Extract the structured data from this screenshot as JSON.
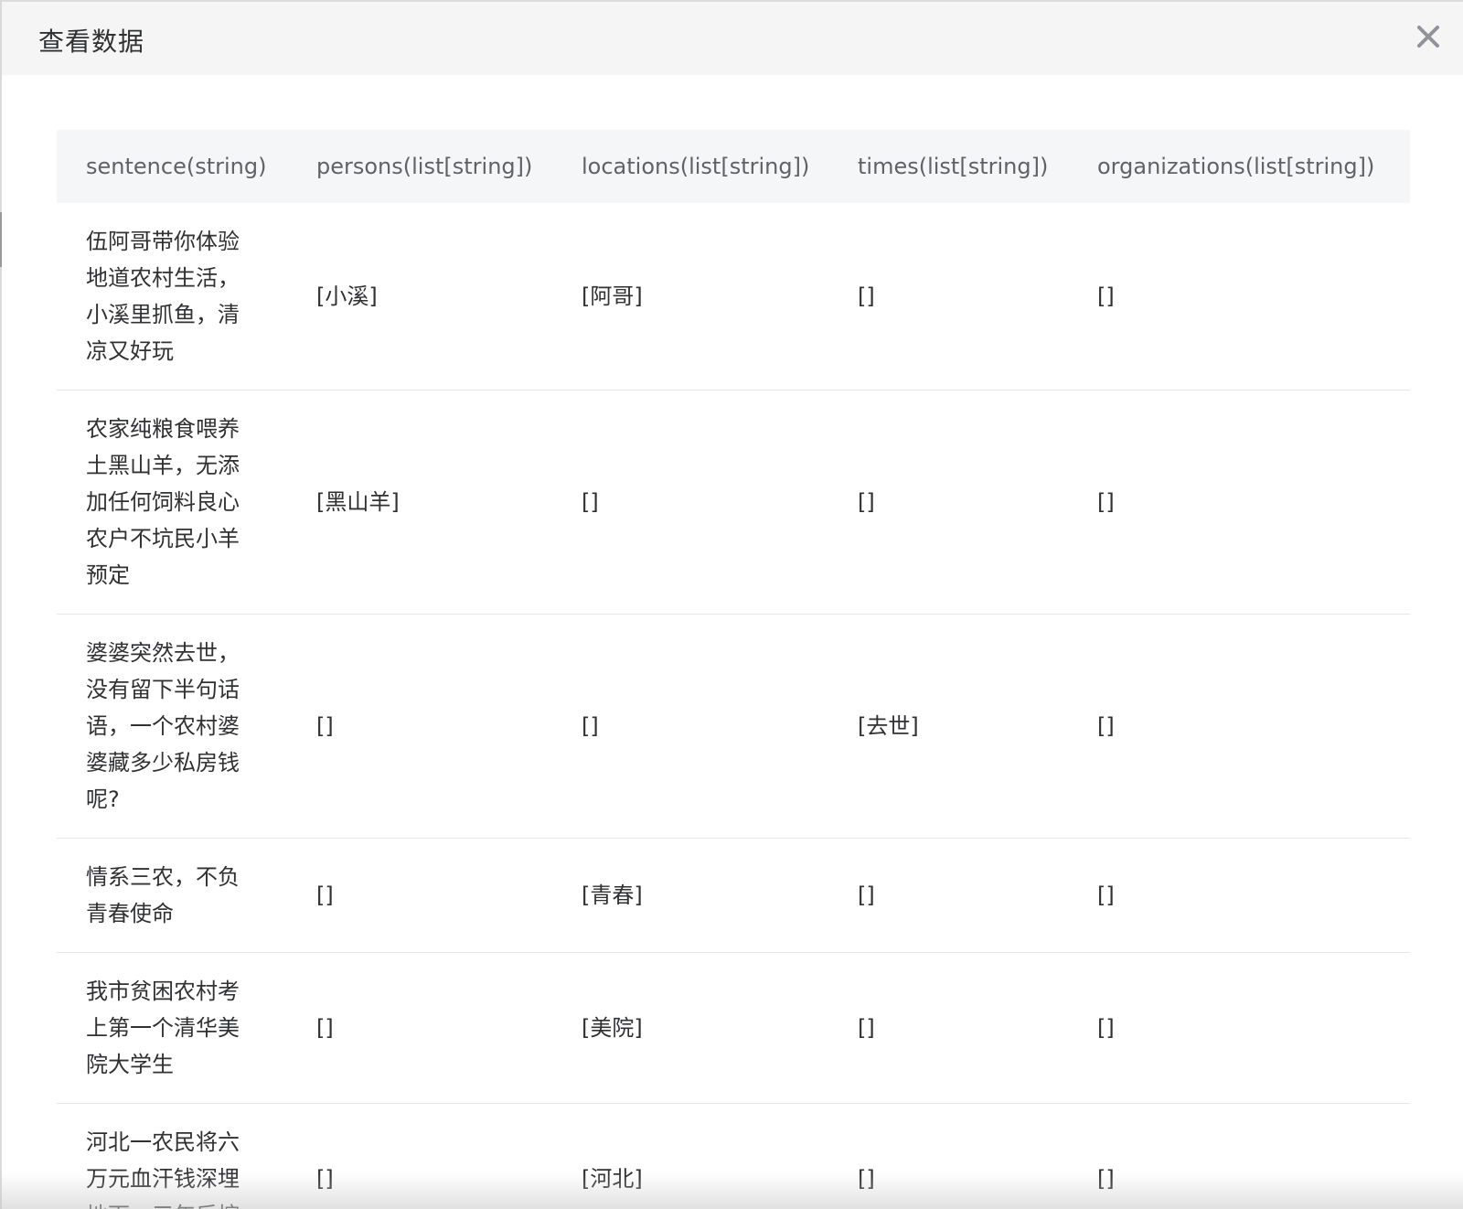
{
  "dialog": {
    "title": "查看数据",
    "close_icon": "close-icon"
  },
  "table": {
    "columns": [
      "sentence(string)",
      "persons(list[string])",
      "locations(list[string])",
      "times(list[string])",
      "organizations(list[string])"
    ],
    "rows": [
      {
        "sentence": "伍阿哥带你体验地道农村生活，小溪里抓鱼，清凉又好玩",
        "persons": "[小溪]",
        "locations": "[阿哥]",
        "times": "[]",
        "organizations": "[]"
      },
      {
        "sentence": "农家纯粮食喂养土黑山羊，无添加任何饲料良心农户不坑民小羊预定",
        "persons": "[黑山羊]",
        "locations": "[]",
        "times": "[]",
        "organizations": "[]"
      },
      {
        "sentence": "婆婆突然去世，没有留下半句话语，一个农村婆婆藏多少私房钱呢?",
        "persons": "[]",
        "locations": "[]",
        "times": "[去世]",
        "organizations": "[]"
      },
      {
        "sentence": "情系三农，不负青春使命",
        "persons": "[]",
        "locations": "[青春]",
        "times": "[]",
        "organizations": "[]"
      },
      {
        "sentence": "我市贫困农村考上第一个清华美院大学生",
        "persons": "[]",
        "locations": "[美院]",
        "times": "[]",
        "organizations": "[]"
      },
      {
        "sentence": "河北一农民将六万元血汗钱深埋地下，三年后挖",
        "persons": "[]",
        "locations": "[河北]",
        "times": "[]",
        "organizations": "[]"
      }
    ]
  }
}
